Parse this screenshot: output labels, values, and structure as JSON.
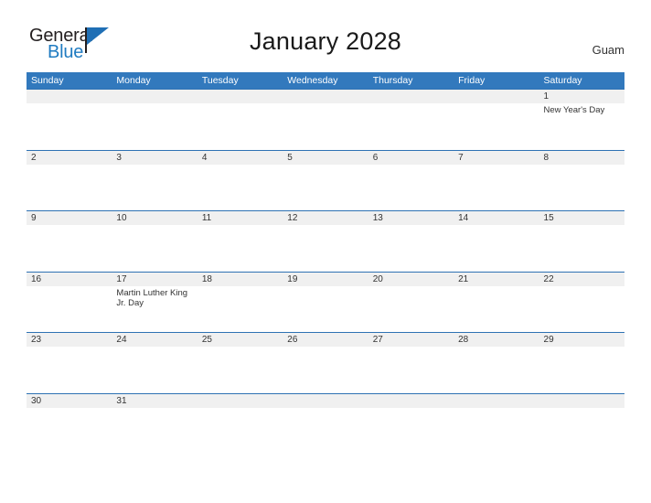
{
  "header": {
    "logo": {
      "word_one": "General",
      "word_two": "Blue",
      "flag_icon": "blue-flag-triangle-icon",
      "brand_dark": "#231f20",
      "brand_blue": "#1f7bc1"
    },
    "title": "January 2028",
    "region": "Guam"
  },
  "theme": {
    "header_blue": "#3279bd",
    "row_border_blue": "#2e72b3",
    "date_band_gray": "#f0f0f0",
    "page_background": "#ffffff",
    "text_color": "#333333"
  },
  "calendar": {
    "weekdays": [
      "Sunday",
      "Monday",
      "Tuesday",
      "Wednesday",
      "Thursday",
      "Friday",
      "Saturday"
    ],
    "weeks": [
      {
        "days": [
          {
            "number": "",
            "event": ""
          },
          {
            "number": "",
            "event": ""
          },
          {
            "number": "",
            "event": ""
          },
          {
            "number": "",
            "event": ""
          },
          {
            "number": "",
            "event": ""
          },
          {
            "number": "",
            "event": ""
          },
          {
            "number": "1",
            "event": "New Year's Day"
          }
        ]
      },
      {
        "days": [
          {
            "number": "2",
            "event": ""
          },
          {
            "number": "3",
            "event": ""
          },
          {
            "number": "4",
            "event": ""
          },
          {
            "number": "5",
            "event": ""
          },
          {
            "number": "6",
            "event": ""
          },
          {
            "number": "7",
            "event": ""
          },
          {
            "number": "8",
            "event": ""
          }
        ]
      },
      {
        "days": [
          {
            "number": "9",
            "event": ""
          },
          {
            "number": "10",
            "event": ""
          },
          {
            "number": "11",
            "event": ""
          },
          {
            "number": "12",
            "event": ""
          },
          {
            "number": "13",
            "event": ""
          },
          {
            "number": "14",
            "event": ""
          },
          {
            "number": "15",
            "event": ""
          }
        ]
      },
      {
        "days": [
          {
            "number": "16",
            "event": ""
          },
          {
            "number": "17",
            "event": "Martin Luther King Jr. Day"
          },
          {
            "number": "18",
            "event": ""
          },
          {
            "number": "19",
            "event": ""
          },
          {
            "number": "20",
            "event": ""
          },
          {
            "number": "21",
            "event": ""
          },
          {
            "number": "22",
            "event": ""
          }
        ]
      },
      {
        "days": [
          {
            "number": "23",
            "event": ""
          },
          {
            "number": "24",
            "event": ""
          },
          {
            "number": "25",
            "event": ""
          },
          {
            "number": "26",
            "event": ""
          },
          {
            "number": "27",
            "event": ""
          },
          {
            "number": "28",
            "event": ""
          },
          {
            "number": "29",
            "event": ""
          }
        ]
      },
      {
        "days": [
          {
            "number": "30",
            "event": ""
          },
          {
            "number": "31",
            "event": ""
          },
          {
            "number": "",
            "event": ""
          },
          {
            "number": "",
            "event": ""
          },
          {
            "number": "",
            "event": ""
          },
          {
            "number": "",
            "event": ""
          },
          {
            "number": "",
            "event": ""
          }
        ]
      }
    ]
  }
}
